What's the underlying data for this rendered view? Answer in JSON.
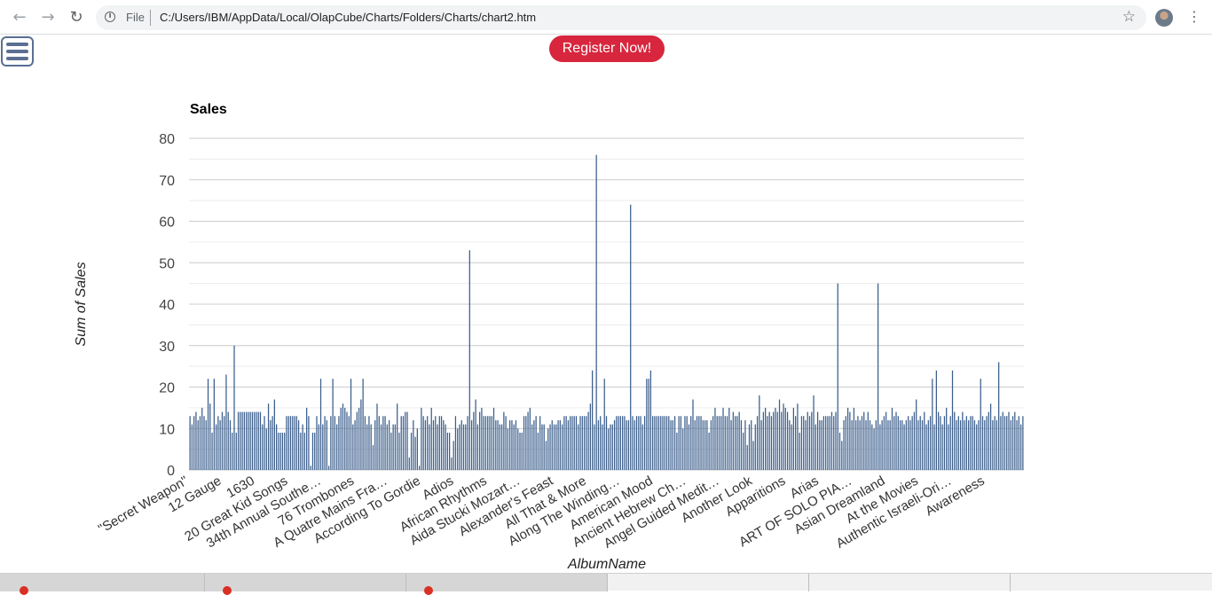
{
  "browser": {
    "scheme": "File",
    "url": "C:/Users/IBM/AppData/Local/OlapCube/Charts/Folders/Charts/chart2.htm"
  },
  "page": {
    "register_label": "Register Now!"
  },
  "colors": {
    "bar": "#3b5e8c",
    "grid": "#cccccc",
    "register_bg": "#d7263d",
    "menu": "#5a6f92"
  },
  "icons": [
    "back-arrow-icon",
    "forward-arrow-icon",
    "reload-icon",
    "info-icon",
    "star-icon",
    "avatar",
    "menu-dots-icon",
    "hamburger-menu-icon"
  ],
  "chart_data": {
    "type": "bar",
    "title": "Sales",
    "xlabel": "AlbumName",
    "ylabel": "Sum of Sales",
    "ylim": [
      0,
      80
    ],
    "yticks": [
      0,
      10,
      20,
      30,
      40,
      50,
      60,
      70,
      80
    ],
    "grid": true,
    "legend": "none",
    "category_count": 380,
    "visible_tick_labels": [
      "\"Secret Weapon\"",
      "12 Gauge",
      "1630",
      "20 Great Kid Songs",
      "34th Annual Southe…",
      "76 Trombones",
      "A Quatre Mains Fra…",
      "According To Gordie",
      "Adios",
      "African Rhythms",
      "Aida Stucki Mozart…",
      "Alexander's Feast",
      "All That & More",
      "Along The Winding…",
      "American Mood",
      "Ancient Hebrew Ch…",
      "Angel Guided Medit…",
      "Another Look",
      "Apparitions",
      "Arias",
      "ART OF SOLO PIA…",
      "Asian Dreamland",
      "At the Movies",
      "Authentic Israeli-Ori…",
      "Awareness"
    ],
    "values": [
      13,
      11,
      13,
      14,
      12,
      13,
      15,
      13,
      12,
      22,
      16,
      9,
      22,
      11,
      13,
      12,
      14,
      13,
      23,
      14,
      12,
      9,
      30,
      9,
      14,
      14,
      14,
      14,
      14,
      14,
      14,
      14,
      14,
      14,
      14,
      14,
      11,
      13,
      10,
      16,
      12,
      13,
      17,
      11,
      9,
      9,
      9,
      9,
      13,
      13,
      13,
      13,
      13,
      13,
      12,
      9,
      11,
      9,
      15,
      13,
      1,
      9,
      9,
      13,
      11,
      22,
      11,
      13,
      12,
      1,
      13,
      22,
      13,
      11,
      13,
      15,
      16,
      15,
      14,
      13,
      22,
      11,
      12,
      14,
      15,
      17,
      22,
      13,
      11,
      13,
      11,
      6,
      12,
      16,
      13,
      11,
      13,
      13,
      11,
      12,
      9,
      11,
      11,
      16,
      9,
      13,
      13,
      14,
      14,
      3,
      9,
      12,
      8,
      10,
      1,
      15,
      13,
      12,
      13,
      11,
      15,
      12,
      13,
      11,
      13,
      13,
      12,
      11,
      9,
      9,
      3,
      7,
      13,
      10,
      11,
      12,
      11,
      11,
      13,
      53,
      12,
      14,
      17,
      11,
      14,
      15,
      13,
      13,
      13,
      13,
      13,
      15,
      12,
      12,
      11,
      11,
      14,
      13,
      10,
      12,
      12,
      11,
      12,
      10,
      9,
      9,
      13,
      13,
      14,
      15,
      11,
      12,
      13,
      9,
      13,
      11,
      11,
      7,
      10,
      11,
      12,
      11,
      11,
      12,
      12,
      11,
      13,
      13,
      12,
      13,
      13,
      13,
      13,
      11,
      13,
      13,
      13,
      13,
      14,
      16,
      24,
      11,
      76,
      12,
      13,
      11,
      22,
      13,
      10,
      11,
      11,
      12,
      13,
      13,
      13,
      13,
      13,
      12,
      12,
      64,
      13,
      12,
      13,
      13,
      13,
      11,
      13,
      22,
      22,
      24,
      13,
      13,
      13,
      13,
      13,
      13,
      13,
      13,
      13,
      12,
      12,
      13,
      9,
      13,
      13,
      10,
      13,
      13,
      11,
      13,
      17,
      12,
      13,
      13,
      13,
      12,
      12,
      12,
      9,
      12,
      13,
      15,
      13,
      13,
      13,
      15,
      13,
      13,
      15,
      12,
      14,
      13,
      13,
      14,
      12,
      9,
      12,
      6,
      11,
      12,
      7,
      11,
      13,
      18,
      12,
      14,
      15,
      13,
      14,
      13,
      14,
      15,
      14,
      17,
      14,
      16,
      15,
      14,
      12,
      11,
      15,
      13,
      16,
      9,
      13,
      13,
      12,
      14,
      13,
      14,
      18,
      11,
      14,
      12,
      12,
      13,
      13,
      13,
      13,
      14,
      13,
      14,
      45,
      9,
      7,
      12,
      13,
      15,
      14,
      12,
      15,
      12,
      13,
      12,
      13,
      14,
      12,
      14,
      12,
      11,
      10,
      12,
      45,
      11,
      12,
      13,
      14,
      12,
      12,
      15,
      13,
      14,
      13,
      12,
      12,
      11,
      12,
      13,
      12,
      13,
      14,
      17,
      12,
      13,
      12,
      14,
      11,
      12,
      13,
      22,
      11,
      24,
      14,
      13,
      11,
      13,
      15,
      11,
      13,
      24,
      14,
      12,
      13,
      12,
      14,
      12,
      13,
      12,
      13,
      13,
      12,
      11,
      12,
      22,
      13,
      12,
      13,
      14,
      16,
      12,
      13,
      12,
      26,
      13,
      14,
      13,
      13,
      14,
      12,
      13,
      14,
      12,
      13,
      11,
      13
    ]
  }
}
